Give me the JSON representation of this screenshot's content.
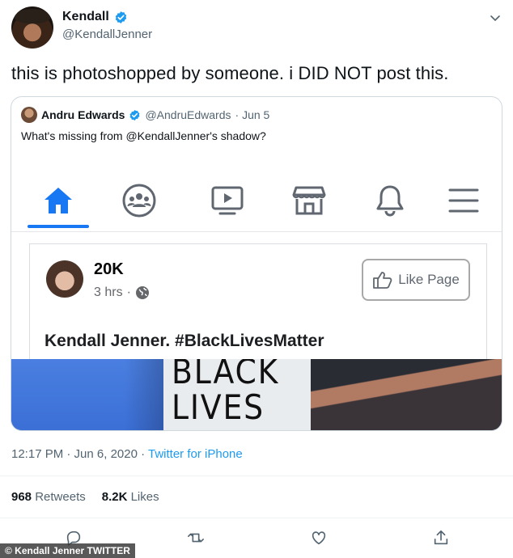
{
  "tweet": {
    "display_name": "Kendall",
    "handle": "@KendallJenner",
    "text": "this is photoshopped by someone. i DID NOT post this.",
    "timestamp": "12:17 PM · Jun 6, 2020 · ",
    "source": "Twitter for iPhone",
    "retweets_count": "968",
    "retweets_label": "Retweets",
    "likes_count": "8.2K",
    "likes_label": "Likes"
  },
  "quote": {
    "display_name": "Andru Edwards",
    "handle": "@AndruEdwards",
    "date": "· Jun 5",
    "text": "What's missing from @KendallJenner's shadow?"
  },
  "fb_screenshot": {
    "nav_icons": [
      "home-icon",
      "groups-icon",
      "watch-icon",
      "marketplace-icon",
      "bell-icon",
      "menu-icon"
    ],
    "active_color": "#1877f2",
    "page_count": "20K",
    "post_time": "3 hrs",
    "meta_separator": "·",
    "like_button_label": "Like Page",
    "caption": "Kendall Jenner. #BlackLivesMatter",
    "sign_text_line1": "BLACK",
    "sign_text_line2": "LIVES"
  },
  "watermark": "© Kendall Jenner TWITTER",
  "colors": {
    "verified": "#1d9bf0",
    "link": "#1d9bf0",
    "secondary_text": "#536471"
  }
}
